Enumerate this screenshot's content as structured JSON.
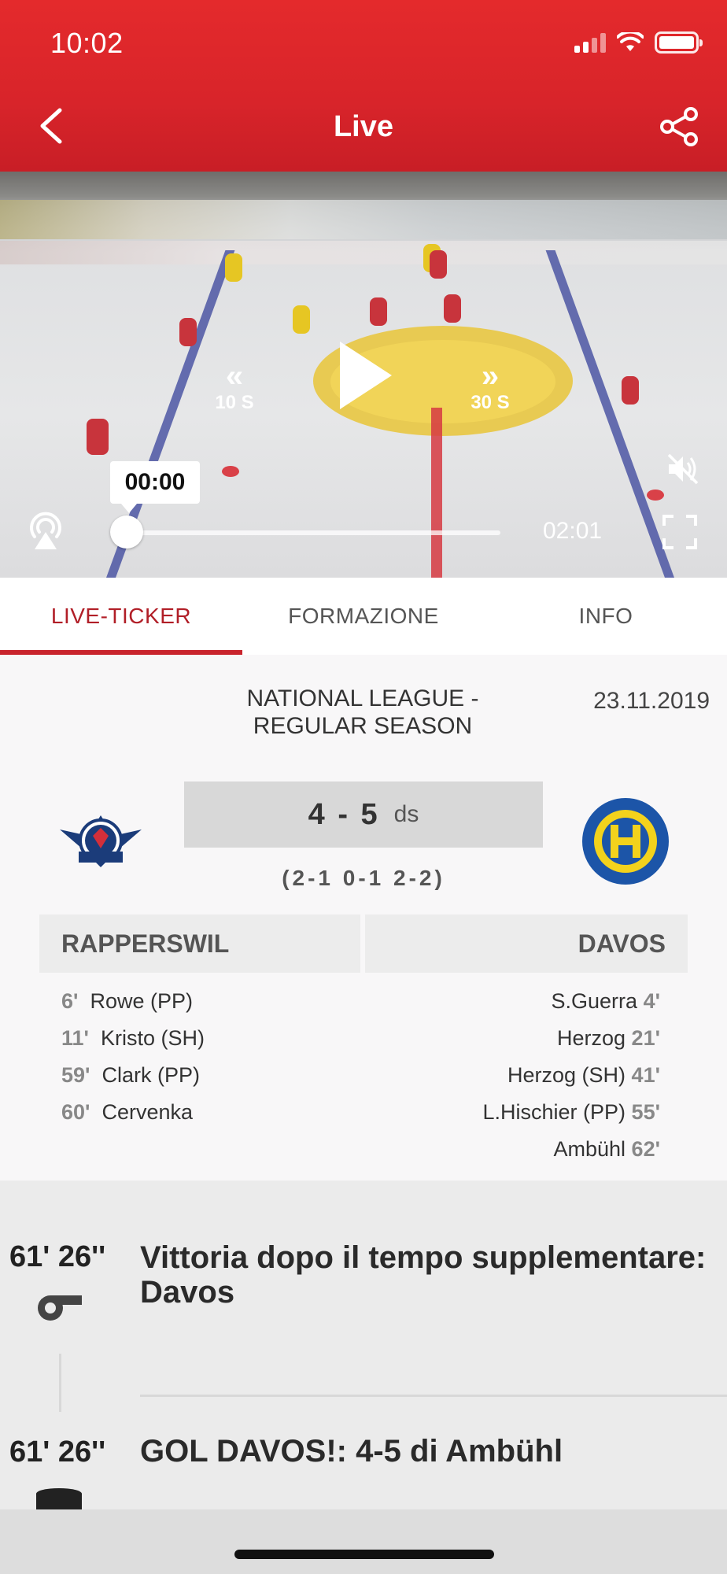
{
  "status_bar": {
    "time": "10:02"
  },
  "header": {
    "title": "Live"
  },
  "player": {
    "rewind_label": "10 S",
    "forward_label": "30 S",
    "current_time": "00:00",
    "duration": "02:01",
    "progress_fraction": 0.0
  },
  "tabs": [
    {
      "label": "LIVE-TICKER",
      "active": true
    },
    {
      "label": "FORMAZIONE",
      "active": false
    },
    {
      "label": "INFO",
      "active": false
    }
  ],
  "match": {
    "league_line1": "NATIONAL LEAGUE -",
    "league_line2": "REGULAR SEASON",
    "date": "23.11.2019",
    "score": "4 - 5",
    "score_suffix": "ds",
    "periods": "(2-1 0-1 2-2)",
    "home_team": "RAPPERSWIL",
    "away_team": "DAVOS",
    "home_goals": [
      {
        "min": "6'",
        "text": "Rowe (PP)"
      },
      {
        "min": "11'",
        "text": "Kristo (SH)"
      },
      {
        "min": "59'",
        "text": "Clark (PP)"
      },
      {
        "min": "60'",
        "text": "Cervenka"
      }
    ],
    "away_goals": [
      {
        "text": "S.Guerra",
        "min": "4'"
      },
      {
        "text": "Herzog",
        "min": "21'"
      },
      {
        "text": "Herzog (SH)",
        "min": "41'"
      },
      {
        "text": "L.Hischier (PP)",
        "min": "55'"
      },
      {
        "text": "Ambühl",
        "min": "62'"
      }
    ]
  },
  "ticker": [
    {
      "time": "61' 26''",
      "text": "Vittoria dopo il tempo supplementare: Davos",
      "icon": "whistle-icon"
    },
    {
      "time": "61' 26''",
      "text": "GOL DAVOS!: 4-5 di Ambühl",
      "icon": "puck-icon"
    }
  ],
  "colors": {
    "brand_red": "#d8242a",
    "tab_active": "#b11e27"
  }
}
